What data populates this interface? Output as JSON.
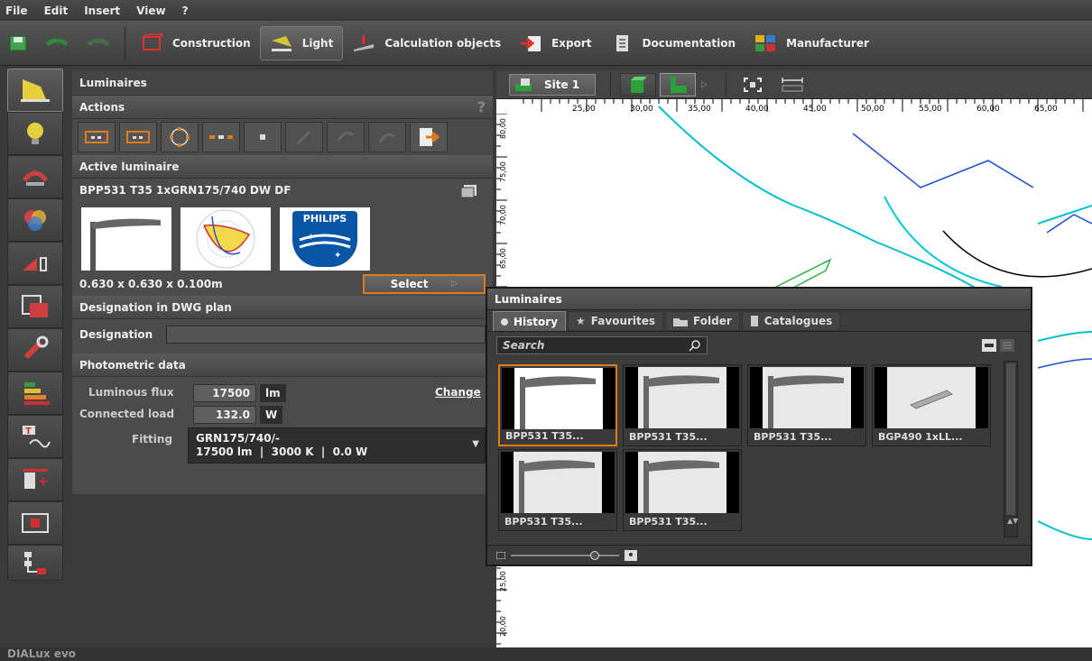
{
  "menu": {
    "file": "File",
    "edit": "Edit",
    "insert": "Insert",
    "view": "View",
    "help": "?"
  },
  "ribbon": {
    "construction": "Construction",
    "light": "Light",
    "calc": "Calculation objects",
    "export": "Export",
    "documentation": "Documentation",
    "manufacturer": "Manufacturer"
  },
  "panel": {
    "title": "Luminaires",
    "actions": "Actions",
    "help": "?",
    "active_title": "Active luminaire",
    "luminaire_name": "BPP531 T35 1xGRN175/740 DW DF",
    "brand": "PHILIPS",
    "dimensions": "0.630 x 0.630 x 0.100m",
    "select": "Select",
    "designation_title": "Designation in DWG plan",
    "designation_label": "Designation",
    "photometric_title": "Photometric data",
    "flux_label": "Luminous flux",
    "flux_value": "17500",
    "flux_unit": "lm",
    "change": "Change",
    "load_label": "Connected load",
    "load_value": "132.0",
    "load_unit": "W",
    "fitting_label": "Fitting",
    "fitting_line1": "GRN175/740/-",
    "fitting_line2": "17500 lm  |  3000 K  |  0.0 W"
  },
  "canvas": {
    "site": "Site 1",
    "ruler_x": [
      "25,00",
      "30,00",
      "35,00",
      "40,00",
      "45,00",
      "50,00",
      "55,00",
      "60,00",
      "65,00"
    ],
    "ruler_y": [
      "80,00",
      "75,00",
      "70,00",
      "65,00",
      "25,00",
      "20,00"
    ]
  },
  "popup": {
    "title": "Luminaires",
    "tabs": [
      "History",
      "Favourites",
      "Folder",
      "Catalogues"
    ],
    "search_placeholder": "Search",
    "items": [
      "BPP531 T35...",
      "BPP531 T35...",
      "BPP531 T35...",
      "BGP490 1xLL...",
      "BPP531 T35...",
      "BPP531 T35..."
    ]
  },
  "status": {
    "logo": "DIALux evo"
  },
  "colors": {
    "accent": "#e07b1a",
    "bg": "#3b3b3b",
    "panel": "#4b4b4b",
    "cyan": "#00c8d7"
  }
}
